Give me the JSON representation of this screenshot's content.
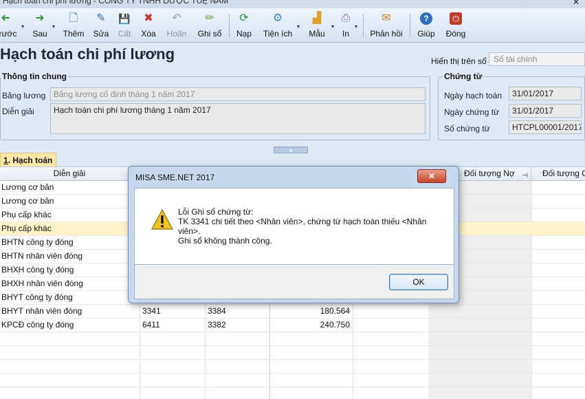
{
  "window": {
    "title": "Hạch toán chi phí lương - CÔNG TY TNHH DƯỢC TUỆ NAM",
    "close_glyph": "✕"
  },
  "toolbar": {
    "buttons": [
      {
        "label": "Trước",
        "icon": "arrow-left-icon",
        "glyph": "➜",
        "color": "#2e9a2e"
      },
      {
        "label": "Sau",
        "icon": "arrow-right-icon",
        "glyph": "➜",
        "color": "#2e9a2e"
      },
      {
        "label": "Thêm",
        "icon": "add-document-icon",
        "glyph": "🗋",
        "color": "#3a6db5"
      },
      {
        "label": "Sửa",
        "icon": "edit-document-icon",
        "glyph": "✎",
        "color": "#3a6db5"
      },
      {
        "label": "Cất",
        "icon": "save-icon",
        "glyph": "💾",
        "color": "#9aa3ad"
      },
      {
        "label": "Xóa",
        "icon": "delete-icon",
        "glyph": "✖",
        "color": "#c8332b"
      },
      {
        "label": "Hoãn",
        "icon": "undo-icon",
        "glyph": "↶",
        "color": "#9aa3ad"
      },
      {
        "label": "Ghi sổ",
        "icon": "pencil-icon",
        "glyph": "✏",
        "color": "#6aa531"
      },
      {
        "label": "Nạp",
        "icon": "refresh-icon",
        "glyph": "⟳",
        "color": "#2e8f3e"
      },
      {
        "label": "Tiện ích",
        "icon": "utilities-icon",
        "glyph": "⚙",
        "color": "#3c8ac4"
      },
      {
        "label": "Mẫu",
        "icon": "template-chart-icon",
        "glyph": "▟",
        "color": "#e0a02c"
      },
      {
        "label": "In",
        "icon": "printer-icon",
        "glyph": "⎙",
        "color": "#7a62c2"
      },
      {
        "label": "Phản hồi",
        "icon": "mail-icon",
        "glyph": "✉",
        "color": "#e07a1e"
      },
      {
        "label": "Giúp",
        "icon": "help-icon",
        "glyph": "?",
        "color": "#2d6fc4"
      },
      {
        "label": "Đóng",
        "icon": "power-icon",
        "glyph": "⏻",
        "color": "#c0392b"
      }
    ],
    "dropdown_glyph": "▾"
  },
  "page": {
    "title": "Hạch toán chi phí lương",
    "display_label": "Hiển thị trên sổ",
    "display_value": "Sổ tài chính"
  },
  "general_info": {
    "title": "Thông tin chung",
    "salary_sheet_label": "Bảng lương",
    "salary_sheet_value": "Bảng lương cố định tháng 1 năm 2017",
    "description_label": "Diễn giải",
    "description_value": "Hạch toán chi phí lương tháng 1 năm 2017"
  },
  "voucher": {
    "title": "Chứng từ",
    "posting_date_label": "Ngày hạch toán",
    "posting_date_value": "31/01/2017",
    "voucher_date_label": "Ngày chứng từ",
    "voucher_date_value": "31/01/2017",
    "voucher_no_label": "Số chứng từ",
    "voucher_no_value": "HTCPL00001/2017"
  },
  "collapse_glyph": "▴",
  "tab": {
    "number": "1",
    "label": ". Hạch toán"
  },
  "grid": {
    "headers": {
      "description": "Diễn giải",
      "debit_object": "Đối tượng Nợ",
      "credit_object": "Đối tượng Có",
      "pin_glyph": "⊣"
    },
    "rows": [
      {
        "description": "Lương cơ bản",
        "debit": "",
        "credit": "",
        "amount": ""
      },
      {
        "description": "Lương cơ bản",
        "debit": "",
        "credit": "",
        "amount": ""
      },
      {
        "description": "Phụ cấp khác",
        "debit": "",
        "credit": "",
        "amount": ""
      },
      {
        "description": "Phụ cấp khác",
        "debit": "",
        "credit": "",
        "amount": ""
      },
      {
        "description": "BHTN công ty đóng",
        "debit": "",
        "credit": "",
        "amount": ""
      },
      {
        "description": "BHTN nhân viên đóng",
        "debit": "",
        "credit": "",
        "amount": ""
      },
      {
        "description": "BHXH công ty đóng",
        "debit": "",
        "credit": "",
        "amount": ""
      },
      {
        "description": "BHXH nhân viên đóng",
        "debit": "",
        "credit": "",
        "amount": ""
      },
      {
        "description": "BHYT công ty đóng",
        "debit": "",
        "credit": "",
        "amount": ""
      },
      {
        "description": "BHYT nhân viên đóng",
        "debit": "3341",
        "credit": "3384",
        "amount": "180.564"
      },
      {
        "description": "KPCĐ công ty đóng",
        "debit": "6411",
        "credit": "3382",
        "amount": "240.750"
      }
    ],
    "selected_row": 3
  },
  "dialog": {
    "title": "MISA SME.NET 2017",
    "close_glyph": "✕",
    "message_lines": [
      "Lỗi Ghi sổ chứng từ:",
      "TK 3341 chi tiết theo <Nhân viên>, chứng từ hạch toán thiếu <Nhân",
      "viên>.",
      "Ghi sổ không thành công."
    ],
    "ok_label": "OK"
  }
}
